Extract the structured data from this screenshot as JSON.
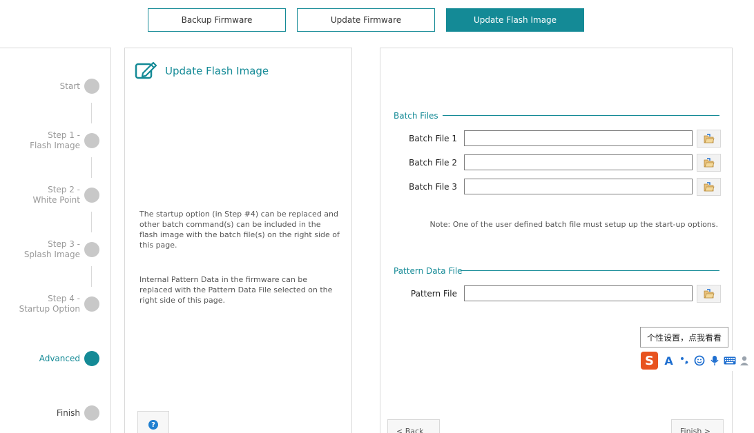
{
  "tabs": [
    {
      "label": "Backup Firmware",
      "active": false
    },
    {
      "label": "Update Firmware",
      "active": false
    },
    {
      "label": "Update Flash Image",
      "active": true
    }
  ],
  "steps": [
    {
      "line1": "Start",
      "line2": ""
    },
    {
      "line1": "Step 1 -",
      "line2": "Flash Image"
    },
    {
      "line1": "Step 2 -",
      "line2": "White Point"
    },
    {
      "line1": "Step 3 -",
      "line2": "Splash Image"
    },
    {
      "line1": "Step 4 -",
      "line2": "Startup Option"
    },
    {
      "line1": "Advanced",
      "line2": ""
    },
    {
      "line1": "Finish",
      "line2": ""
    }
  ],
  "info": {
    "title": "Update Flash Image",
    "paragraph1": "The startup option (in Step #4) can be replaced and other batch command(s) can be included in the flash image with the batch file(s) on the right side of this page.",
    "paragraph2": "Internal Pattern Data in the firmware can be replaced with the Pattern Data File selected on the right side of this page.",
    "help_icon": "?"
  },
  "batch": {
    "section_title": "Batch Files",
    "fields": [
      {
        "label": "Batch File 1",
        "value": ""
      },
      {
        "label": "Batch File 2",
        "value": ""
      },
      {
        "label": "Batch File 3",
        "value": ""
      }
    ],
    "note": "Note: One of the user defined batch file must setup up the start-up options."
  },
  "pattern": {
    "section_title": "Pattern Data File",
    "field_label": "Pattern File",
    "value": ""
  },
  "nav": {
    "back_label": "< Back",
    "finish_label": "Finish >"
  },
  "ime": {
    "tooltip": "个性设置，点我看看",
    "logo": "S",
    "icons": [
      "font-icon",
      "punctuation-icon",
      "emoji-icon",
      "microphone-icon",
      "keyboard-icon",
      "user-icon"
    ]
  },
  "colors": {
    "accent": "#148a96",
    "inactive": "#c8c8c8"
  }
}
